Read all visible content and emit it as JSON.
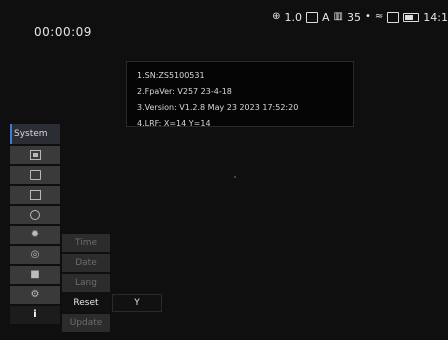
{
  "status": {
    "zoom": "1.0",
    "mode": "A",
    "sensor_value": "35",
    "time": "14:1"
  },
  "timer": "00:00:09",
  "info": {
    "lines": [
      "1.SN:ZS5100531",
      "2.FpaVer: V257  23-4-18",
      "3.Version: V1.2.8  May  23  2023  17:52:20",
      "4.LRF:  X=14  Y=14"
    ]
  },
  "menu": {
    "header": "System",
    "icons": [
      "image-icon",
      "record-icon",
      "photo-icon",
      "target-icon",
      "brightness-icon",
      "globe-icon",
      "folder-icon",
      "settings-icon",
      "info-icon"
    ]
  },
  "submenu": {
    "items": [
      "Time",
      "Date",
      "Lang",
      "Reset",
      "Update"
    ],
    "active": "Reset"
  },
  "value": "Y",
  "colors": {
    "accent": "#3d7bd4"
  }
}
